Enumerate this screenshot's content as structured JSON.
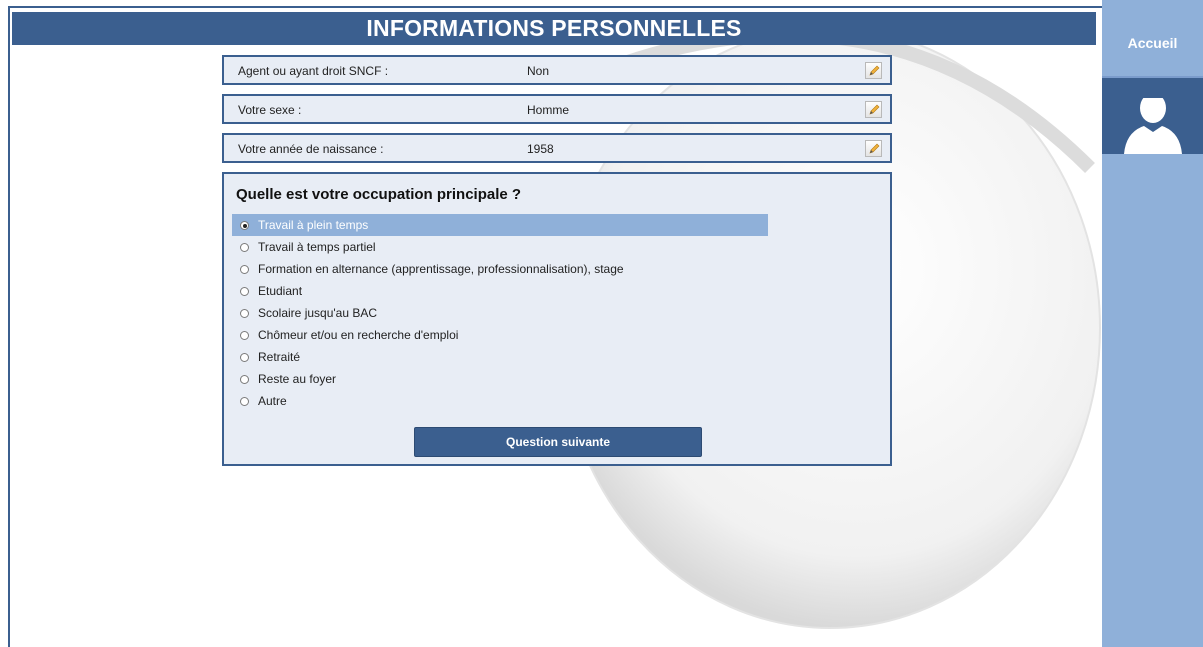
{
  "header": {
    "title": "INFORMATIONS PERSONNELLES"
  },
  "summary_rows": [
    {
      "label": "Agent ou ayant droit SNCF :",
      "value": "Non"
    },
    {
      "label": "Votre sexe :",
      "value": "Homme"
    },
    {
      "label": "Votre année de naissance :",
      "value": "1958"
    }
  ],
  "question": {
    "title": "Quelle est votre occupation principale ?",
    "options": [
      {
        "label": "Travail à plein temps",
        "selected": true
      },
      {
        "label": "Travail à temps partiel",
        "selected": false
      },
      {
        "label": "Formation en alternance (apprentissage, professionnalisation), stage",
        "selected": false
      },
      {
        "label": "Etudiant",
        "selected": false
      },
      {
        "label": "Scolaire jusqu'au BAC",
        "selected": false
      },
      {
        "label": "Chômeur et/ou en recherche d'emploi",
        "selected": false
      },
      {
        "label": "Retraité",
        "selected": false
      },
      {
        "label": "Reste au foyer",
        "selected": false
      },
      {
        "label": "Autre",
        "selected": false
      }
    ],
    "next_label": "Question suivante"
  },
  "sidebar": {
    "home_label": "Accueil",
    "avatar_icon": "user-silhouette-icon"
  },
  "colors": {
    "primary": "#3b5f8f",
    "sidebar": "#8fb0d9",
    "panel": "#e8edf5",
    "selected": "#8fb0d9"
  }
}
